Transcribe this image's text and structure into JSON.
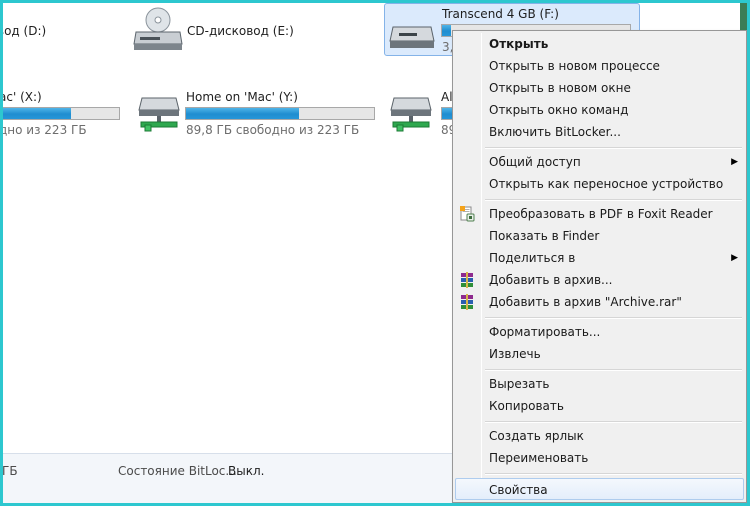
{
  "drives": {
    "d": {
      "label": "вод (D:)"
    },
    "e": {
      "label": "CD-дисковод (E:)"
    },
    "f": {
      "label": "Transcend 4 GB (F:)",
      "free_partial": "3,",
      "fill_fraction": 0.05
    },
    "x": {
      "label": "ac' (X:)",
      "free": "дно из 223 ГБ",
      "fill_fraction": 0.6
    },
    "y": {
      "label": "Home on 'Mac' (Y:)",
      "free": "89,8 ГБ свободно из 223 ГБ",
      "fill_fraction": 0.6
    },
    "z": {
      "label": "Al",
      "free_partial": "89"
    }
  },
  "status": {
    "size_partial": "ГБ",
    "bitlocker_label": "Состояние BitLoc...",
    "bitlocker_value": "Выкл."
  },
  "menu": {
    "open": "Открыть",
    "open_new_process": "Открыть в новом процессе",
    "open_new_window": "Открыть в новом окне",
    "open_cmd": "Открыть окно команд",
    "bitlocker": "Включить BitLocker...",
    "sharing": "Общий доступ",
    "open_portable": "Открыть как переносное устройство",
    "to_pdf": "Преобразовать в PDF в Foxit Reader",
    "show_finder": "Показать в Finder",
    "share_in": "Поделиться в",
    "add_archive": "Добавить в архив...",
    "add_archive_rar": "Добавить в архив \"Archive.rar\"",
    "format": "Форматировать...",
    "eject": "Извлечь",
    "cut": "Вырезать",
    "copy": "Копировать",
    "create_shortcut": "Создать ярлык",
    "rename": "Переименовать",
    "properties": "Свойства"
  },
  "colors": {
    "frame": "#2dc7cf",
    "bar_fill": "#2696d8",
    "menu_bg": "#f0f0f0",
    "hover_border": "#aeccee"
  },
  "icons": {
    "pdf": "foxit-pdf-icon",
    "rar": "winrar-archive-icon",
    "submenu": "chevron-right-icon"
  }
}
